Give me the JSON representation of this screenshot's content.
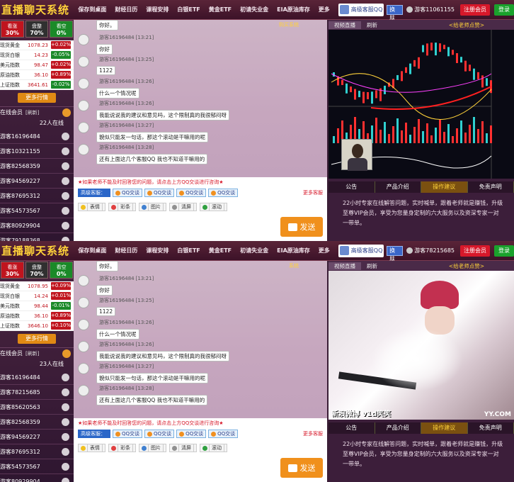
{
  "frames": [
    {
      "brand": "直播聊天系统",
      "nav": [
        "保存到桌面",
        "财经日历",
        "课程安排",
        "白银ETF",
        "黄金ETF",
        "初请失业金",
        "EIA原油库存",
        "更多"
      ],
      "qq_service": "高级客服QQ",
      "skin_button": "换肤",
      "guest_id": "游客11061155",
      "register": "注册会员",
      "login": "登录",
      "market": [
        {
          "label": "看涨",
          "value": "30%"
        },
        {
          "label": "盘整",
          "value": "70%"
        },
        {
          "label": "看空",
          "value": "0%"
        }
      ],
      "quotes": [
        {
          "name": "现货黄金",
          "price": "1078.23",
          "change": "+0.02%"
        },
        {
          "name": "现货白银",
          "price": "14.23",
          "change": "-0.05%"
        },
        {
          "name": "美元指数",
          "price": "98.47",
          "change": "+0.02%"
        },
        {
          "name": "原油指数",
          "price": "36.10",
          "change": "+0.89%"
        },
        {
          "name": "上证指数",
          "price": "3641.61",
          "change": "-0.02%"
        }
      ],
      "more_quotes": "更多行情",
      "online_title": "在线会员",
      "refresh": "[刷新]",
      "online_count": "22人在线",
      "users": [
        "游客16196484",
        "游客10321155",
        "游客82568359",
        "游客94569227",
        "游客87695312",
        "游客54573567",
        "游客80929904",
        "游客79188368"
      ],
      "system_label": "购买系统",
      "messages": [
        {
          "user": "游客16196484",
          "time": "[13:21]",
          "text": "你好"
        },
        {
          "user": "游客16196484",
          "time": "[13:25]",
          "text": "1122"
        },
        {
          "user": "游客16196484",
          "time": "[13:26]",
          "text": "什么一个情况呢"
        },
        {
          "user": "游客16196484",
          "time": "[13:26]",
          "text": "我能说说我的建议和意见吗，这个限制真的我很郁闷呀"
        },
        {
          "user": "游客16196484",
          "time": "[13:27]",
          "text": "貌似只能发一句话，那这个滚动是干嘛用的呢"
        },
        {
          "user": "游客16196484",
          "time": "[13:28]",
          "text": "还有上面这几个客服QQ 我也不知道干嘛用的"
        }
      ],
      "top_partial": "你好。",
      "notice": "★如果老师不能及时回答您的问题，请点击上方QQ交谈进行咨询★",
      "kefu": "高级客服：",
      "qq_talk": "QQ交谈",
      "more_kefu": "更多客服",
      "tools": [
        "表情",
        "彩条",
        "图片",
        "清屏",
        "滚动"
      ],
      "send": "发送",
      "video_tabs": [
        "视频直播",
        "刷新"
      ],
      "teacher": "<给老师点赞>",
      "bottom_tabs": [
        "公告",
        "产品介绍",
        "操作建议",
        "免责声明"
      ],
      "intro": "22小时专家在线解答问题，实时喊单，跟着老师就是赚钱，升级至尊VIP会员，享受为您量身定制的六大服务以及资深专家一对一带单。",
      "video_type": "chart"
    },
    {
      "brand": "直播聊天系统",
      "nav": [
        "保存到桌面",
        "财经日历",
        "课程安排",
        "白银ETF",
        "黄金ETF",
        "初请失业金",
        "EIA原油库存",
        "更多"
      ],
      "qq_service": "高级客服QQ",
      "skin_button": "换肤",
      "guest_id": "游客78215685",
      "register": "注册会员",
      "login": "登录",
      "market": [
        {
          "label": "看涨",
          "value": "30%"
        },
        {
          "label": "盘整",
          "value": "70%"
        },
        {
          "label": "看空",
          "value": "0%"
        }
      ],
      "quotes": [
        {
          "name": "现货黄金",
          "price": "1078.95",
          "change": "+0.09%"
        },
        {
          "name": "现货白银",
          "price": "14.24",
          "change": "+0.01%"
        },
        {
          "name": "美元指数",
          "price": "98.44",
          "change": "-0.01%"
        },
        {
          "name": "原油指数",
          "price": "36.10",
          "change": "+0.89%"
        },
        {
          "name": "上证指数",
          "price": "3646.10",
          "change": "+0.10%"
        }
      ],
      "more_quotes": "更多行情",
      "online_title": "在线会员",
      "refresh": "[刷新]",
      "online_count": "23人在线",
      "users": [
        "游客16196484",
        "游客78215685",
        "游客85620563",
        "游客82568359",
        "游客94569227",
        "游客87695312",
        "游客54573567",
        "游客80929904"
      ],
      "system_label": "系统",
      "messages": [
        {
          "user": "游客16196484",
          "time": "[13:21]",
          "text": "你好"
        },
        {
          "user": "游客16196484",
          "time": "[13:25]",
          "text": "1122"
        },
        {
          "user": "游客16196484",
          "time": "[13:26]",
          "text": "什么一个情况呢"
        },
        {
          "user": "游客16196484",
          "time": "[13:26]",
          "text": "我能说说我的建议和意见吗，这个限制真的我很郁闷呀"
        },
        {
          "user": "游客16196484",
          "time": "[13:27]",
          "text": "貌似只能发一句话，那这个滚动是干嘛用的呢"
        },
        {
          "user": "游客16196484",
          "time": "[13:28]",
          "text": "还有上面这几个客服QQ 我也不知道干嘛用的"
        }
      ],
      "top_partial": "你好。",
      "notice": "★如果老师不能及时回答您的问题，请点击上方QQ交谈进行咨询★",
      "kefu": "高级客服：",
      "qq_talk": "QQ交谈",
      "more_kefu": "更多客服",
      "tools": [
        "表情",
        "彩条",
        "图片",
        "清屏",
        "滚动"
      ],
      "send": "发送",
      "video_tabs": [
        "视频直播",
        "刷新"
      ],
      "teacher": "<给老师点赞>",
      "bottom_tabs": [
        "公告",
        "产品介绍",
        "操作建议",
        "免责声明"
      ],
      "intro": "22小时专家在线解答问题，实时喊单，跟着老师就是赚钱，升级至尊VIP会员，享受为您量身定制的六大服务以及资深专家一对一带单。",
      "video_type": "girl",
      "watermark": "新浪微博 v1d笑笑",
      "yy": "YY.COM"
    }
  ],
  "colors": {
    "brand": "#ffd23a",
    "up": "#c0141e",
    "down": "#1a8a28",
    "send": "#f0901c",
    "register": "#d7182a"
  }
}
